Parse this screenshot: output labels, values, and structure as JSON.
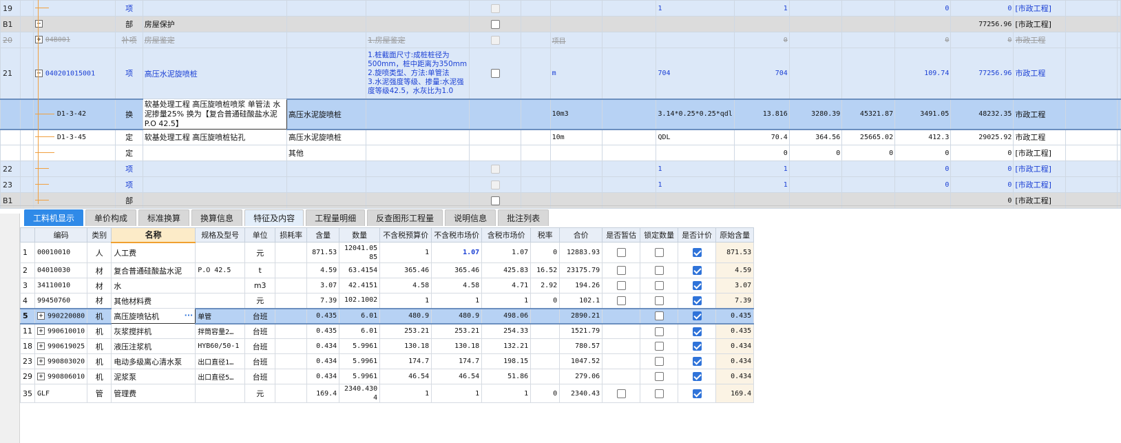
{
  "top_rows": [
    {
      "no": "19",
      "style": "blue",
      "tree": "line",
      "code": "",
      "type": "项",
      "name": "",
      "content": "",
      "feature": "",
      "cb": "dis",
      "unit": "",
      "expr": "1",
      "qty": "1",
      "c13": "",
      "c14": "",
      "c15": "0",
      "c16": "0",
      "spec": "[市政工程]"
    },
    {
      "no": "B1",
      "style": "gray",
      "tree": "minus",
      "code": "",
      "type": "部",
      "name": "房屋保护",
      "content": "",
      "feature": "",
      "cb": "norm",
      "unit": "",
      "expr": "",
      "qty": "",
      "c13": "",
      "c14": "",
      "c15": "",
      "c16": "77256.96",
      "spec": "[市政工程]"
    },
    {
      "no": "20",
      "style": "blue strike",
      "tree": "plus",
      "code": "04B001",
      "type": "补项",
      "name": "房屋鉴定",
      "content": "",
      "feature": "1.房屋鉴定",
      "cb": "dis",
      "unit": "项目",
      "expr": "",
      "qty": "0",
      "c13": "",
      "c14": "",
      "c15": "0",
      "c16": "0",
      "spec": "市政工程"
    },
    {
      "no": "21",
      "style": "blue tall",
      "tree": "minus",
      "code": "040201015001",
      "type": "项",
      "name": "高压水泥旋喷桩",
      "content": "",
      "feature": "1.桩截面尺寸:成桩桩径为500mm，桩中距离为350mm\n2.旋喷类型、方法:单管法\n3.水泥强度等级、掺量:水泥强度等级42.5，水灰比为1.0",
      "cb": "norm",
      "unit": "m",
      "expr": "704",
      "qty": "704",
      "c13": "",
      "c14": "",
      "c15": "109.74",
      "c16": "77256.96",
      "spec": "市政工程"
    },
    {
      "no": "",
      "style": "sel",
      "tree": "sub",
      "code": "D1-3-42",
      "type": "换",
      "name": "软基处理工程 高压旋喷桩喷浆 单管法 水泥掺量25% 换为【复合普通硅酸盐水泥P.O 42.5】",
      "content": "高压水泥旋喷桩",
      "feature": "",
      "cb": "none",
      "unit": "10m3",
      "expr": "3.14*0.25*0.25*qdl",
      "qty": "13.816",
      "c13": "3280.39",
      "c14": "45321.87",
      "c15": "3491.05",
      "c16": "48232.35",
      "spec": "市政工程"
    },
    {
      "no": "",
      "style": "white",
      "tree": "sub",
      "code": "D1-3-45",
      "type": "定",
      "name": "软基处理工程 高压旋喷桩钻孔",
      "content": "高压水泥旋喷桩",
      "feature": "",
      "cb": "none",
      "unit": "10m",
      "expr": "QDL",
      "qty": "70.4",
      "c13": "364.56",
      "c14": "25665.02",
      "c15": "412.3",
      "c16": "29025.92",
      "spec": "市政工程"
    },
    {
      "no": "",
      "style": "white",
      "tree": "sub",
      "code": "",
      "type": "定",
      "name": "",
      "content": "其他",
      "feature": "",
      "cb": "none",
      "unit": "",
      "expr": "",
      "qty": "0",
      "c13": "0",
      "c14": "0",
      "c15": "0",
      "c16": "0",
      "spec": "[市政工程]"
    },
    {
      "no": "22",
      "style": "blue",
      "tree": "line",
      "code": "",
      "type": "项",
      "name": "",
      "content": "",
      "feature": "",
      "cb": "dis",
      "unit": "",
      "expr": "1",
      "qty": "1",
      "c13": "",
      "c14": "",
      "c15": "0",
      "c16": "0",
      "spec": "[市政工程]"
    },
    {
      "no": "23",
      "style": "blue",
      "tree": "line",
      "code": "",
      "type": "项",
      "name": "",
      "content": "",
      "feature": "",
      "cb": "dis",
      "unit": "",
      "expr": "1",
      "qty": "1",
      "c13": "",
      "c14": "",
      "c15": "0",
      "c16": "0",
      "spec": "[市政工程]"
    },
    {
      "no": "B1",
      "style": "gray",
      "tree": "line",
      "code": "",
      "type": "部",
      "name": "",
      "content": "",
      "feature": "",
      "cb": "norm",
      "unit": "",
      "expr": "",
      "qty": "",
      "c13": "",
      "c14": "",
      "c15": "",
      "c16": "0",
      "spec": "[市政工程]"
    }
  ],
  "tabs": [
    "工料机显示",
    "单价构成",
    "标准换算",
    "换算信息",
    "特征及内容",
    "工程量明细",
    "反查图形工程量",
    "说明信息",
    "批注列表"
  ],
  "columns": [
    "编码",
    "类别",
    "名称",
    "规格及型号",
    "单位",
    "损耗率",
    "含量",
    "数量",
    "不含税预算价",
    "不含税市场价",
    "含税市场价",
    "税率",
    "合价",
    "是否暂估",
    "锁定数量",
    "是否计价",
    "原始含量"
  ],
  "rows": [
    {
      "no": "1",
      "plus": false,
      "code": "00010010",
      "cat": "人",
      "name": "人工费",
      "spec": "",
      "unit": "元",
      "loss": "",
      "content": "871.53",
      "qty": "12041.0585",
      "budget": "1",
      "market": "1.07",
      "taxmarket": "1.07",
      "tax": "0",
      "total": "12883.93",
      "est": false,
      "lock": false,
      "price": true,
      "orig": "871.53"
    },
    {
      "no": "2",
      "plus": false,
      "code": "04010030",
      "cat": "材",
      "name": "复合普通硅酸盐水泥",
      "spec": "P.O 42.5",
      "unit": "t",
      "loss": "",
      "content": "4.59",
      "qty": "63.4154",
      "budget": "365.46",
      "market": "365.46",
      "taxmarket": "425.83",
      "tax": "16.52",
      "total": "23175.79",
      "est": false,
      "lock": false,
      "price": true,
      "orig": "4.59"
    },
    {
      "no": "3",
      "plus": false,
      "code": "34110010",
      "cat": "材",
      "name": "水",
      "spec": "",
      "unit": "m3",
      "loss": "",
      "content": "3.07",
      "qty": "42.4151",
      "budget": "4.58",
      "market": "4.58",
      "taxmarket": "4.71",
      "tax": "2.92",
      "total": "194.26",
      "est": false,
      "lock": false,
      "price": true,
      "orig": "3.07"
    },
    {
      "no": "4",
      "plus": false,
      "code": "99450760",
      "cat": "材",
      "name": "其他材料费",
      "spec": "",
      "unit": "元",
      "loss": "",
      "content": "7.39",
      "qty": "102.1002",
      "budget": "1",
      "market": "1",
      "taxmarket": "1",
      "tax": "0",
      "total": "102.1",
      "est": false,
      "lock": false,
      "price": true,
      "orig": "7.39"
    },
    {
      "no": "5",
      "plus": true,
      "code": "990220080",
      "cat": "机",
      "name": "高压旋喷钻机",
      "spec": "单管",
      "unit": "台班",
      "loss": "",
      "content": "0.435",
      "qty": "6.01",
      "budget": "480.9",
      "market": "480.9",
      "taxmarket": "498.06",
      "tax": "",
      "total": "2890.21",
      "est": null,
      "lock": false,
      "price": true,
      "orig": "0.435",
      "sel": true
    },
    {
      "no": "11",
      "plus": true,
      "code": "990610010",
      "cat": "机",
      "name": "灰浆搅拌机",
      "spec": "拌筒容量2…",
      "unit": "台班",
      "loss": "",
      "content": "0.435",
      "qty": "6.01",
      "budget": "253.21",
      "market": "253.21",
      "taxmarket": "254.33",
      "tax": "",
      "total": "1521.79",
      "est": null,
      "lock": false,
      "price": true,
      "orig": "0.435"
    },
    {
      "no": "18",
      "plus": true,
      "code": "990619025",
      "cat": "机",
      "name": "液压注浆机",
      "spec": "HYB60/50-1",
      "unit": "台班",
      "loss": "",
      "content": "0.434",
      "qty": "5.9961",
      "budget": "130.18",
      "market": "130.18",
      "taxmarket": "132.21",
      "tax": "",
      "total": "780.57",
      "est": null,
      "lock": false,
      "price": true,
      "orig": "0.434"
    },
    {
      "no": "23",
      "plus": true,
      "code": "990803020",
      "cat": "机",
      "name": "电动多级离心清水泵",
      "spec": "出口直径1…",
      "unit": "台班",
      "loss": "",
      "content": "0.434",
      "qty": "5.9961",
      "budget": "174.7",
      "market": "174.7",
      "taxmarket": "198.15",
      "tax": "",
      "total": "1047.52",
      "est": null,
      "lock": false,
      "price": true,
      "orig": "0.434"
    },
    {
      "no": "29",
      "plus": true,
      "code": "990806010",
      "cat": "机",
      "name": "泥浆泵",
      "spec": "出口直径5…",
      "unit": "台班",
      "loss": "",
      "content": "0.434",
      "qty": "5.9961",
      "budget": "46.54",
      "market": "46.54",
      "taxmarket": "51.86",
      "tax": "",
      "total": "279.06",
      "est": null,
      "lock": false,
      "price": true,
      "orig": "0.434"
    },
    {
      "no": "35",
      "plus": false,
      "code": "GLF",
      "cat": "管",
      "name": "管理费",
      "spec": "",
      "unit": "元",
      "loss": "",
      "content": "169.4",
      "qty": "2340.4304",
      "budget": "1",
      "market": "1",
      "taxmarket": "1",
      "tax": "0",
      "total": "2340.43",
      "est": false,
      "lock": false,
      "price": true,
      "orig": "169.4"
    }
  ],
  "ellipsis": "···"
}
